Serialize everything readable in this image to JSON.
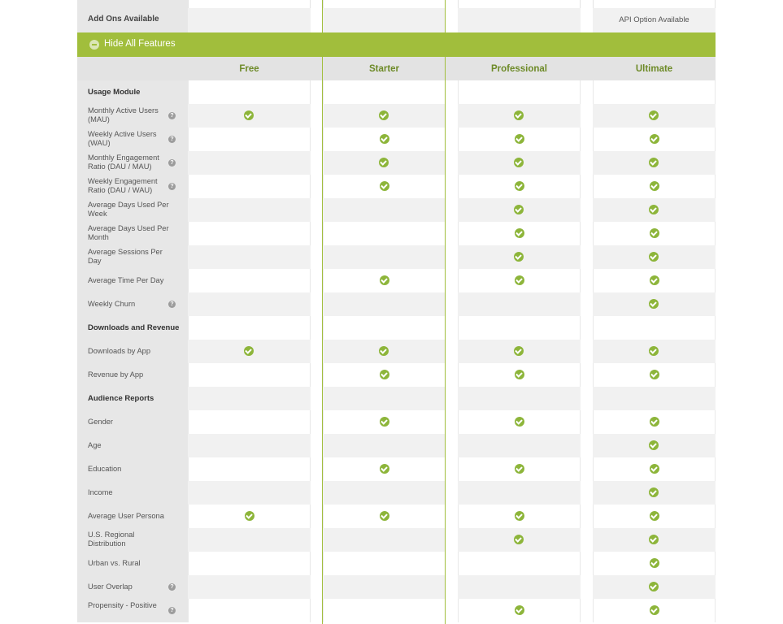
{
  "addons": {
    "label": "Add Ons Available",
    "ultimate": "API Option Available"
  },
  "toggle": {
    "label": "Hide All Features"
  },
  "plans": [
    "Free",
    "Starter",
    "Professional",
    "Ultimate"
  ],
  "colors": {
    "accent": "#a1be3c",
    "check": "#8db53a",
    "plan_text": "#6d8a27"
  },
  "rows": [
    {
      "type": "section",
      "label": "Usage Module"
    },
    {
      "type": "feature",
      "label": "Monthly Active Users (MAU)",
      "help": true,
      "checks": [
        1,
        1,
        1,
        1
      ]
    },
    {
      "type": "feature",
      "label": "Weekly Active Users (WAU)",
      "help": true,
      "checks": [
        0,
        1,
        1,
        1
      ]
    },
    {
      "type": "feature",
      "label": "Monthly Engagement Ratio (DAU / MAU)",
      "help": true,
      "checks": [
        0,
        1,
        1,
        1
      ]
    },
    {
      "type": "feature",
      "label": "Weekly Engagement Ratio (DAU / WAU)",
      "help": true,
      "checks": [
        0,
        1,
        1,
        1
      ]
    },
    {
      "type": "feature",
      "label": "Average Days Used Per Week",
      "help": false,
      "checks": [
        0,
        0,
        1,
        1
      ]
    },
    {
      "type": "feature",
      "label": "Average Days Used Per Month",
      "help": false,
      "checks": [
        0,
        0,
        1,
        1
      ]
    },
    {
      "type": "feature",
      "label": "Average Sessions Per Day",
      "help": false,
      "checks": [
        0,
        0,
        1,
        1
      ]
    },
    {
      "type": "feature",
      "label": "Average Time Per Day",
      "help": false,
      "checks": [
        0,
        1,
        1,
        1
      ]
    },
    {
      "type": "feature",
      "label": "Weekly Churn",
      "help": true,
      "checks": [
        0,
        0,
        0,
        1
      ]
    },
    {
      "type": "section",
      "label": "Downloads and Revenue"
    },
    {
      "type": "feature",
      "label": "Downloads by App",
      "help": false,
      "checks": [
        1,
        1,
        1,
        1
      ]
    },
    {
      "type": "feature",
      "label": "Revenue by App",
      "help": false,
      "checks": [
        0,
        1,
        1,
        1
      ]
    },
    {
      "type": "section",
      "label": "Audience Reports"
    },
    {
      "type": "feature",
      "label": "Gender",
      "help": false,
      "checks": [
        0,
        1,
        1,
        1
      ]
    },
    {
      "type": "feature",
      "label": "Age",
      "help": false,
      "checks": [
        0,
        0,
        0,
        1
      ]
    },
    {
      "type": "feature",
      "label": "Education",
      "help": false,
      "checks": [
        0,
        1,
        1,
        1
      ]
    },
    {
      "type": "feature",
      "label": "Income",
      "help": false,
      "checks": [
        0,
        0,
        0,
        1
      ]
    },
    {
      "type": "feature",
      "label": "Average User Persona",
      "help": false,
      "checks": [
        1,
        1,
        1,
        1
      ]
    },
    {
      "type": "feature",
      "label": "U.S. Regional Distribution",
      "help": false,
      "checks": [
        0,
        0,
        1,
        1
      ]
    },
    {
      "type": "feature",
      "label": "Urban vs. Rural",
      "help": false,
      "checks": [
        0,
        0,
        0,
        1
      ]
    },
    {
      "type": "feature",
      "label": "User Overlap",
      "help": true,
      "checks": [
        0,
        0,
        0,
        1
      ]
    },
    {
      "type": "feature",
      "label": "Propensity - Positive",
      "help": true,
      "checks": [
        0,
        0,
        1,
        1
      ]
    }
  ]
}
